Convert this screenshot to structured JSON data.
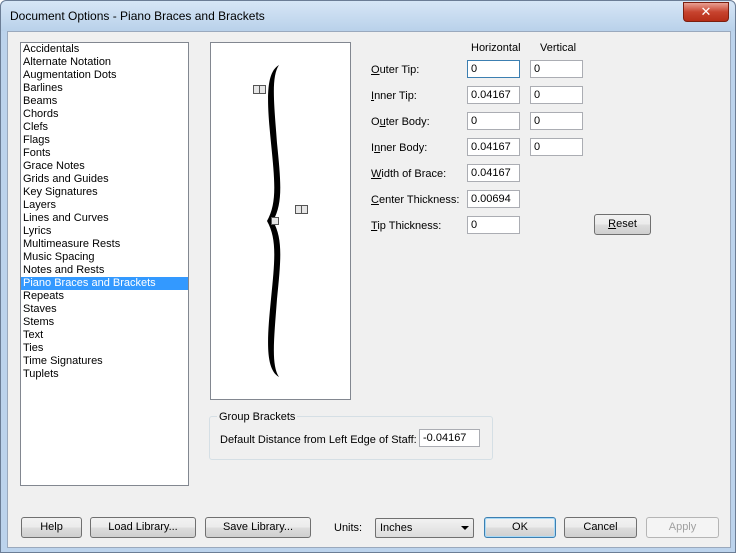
{
  "window": {
    "title": "Document Options - Piano Braces and Brackets",
    "close_symbol": "✕"
  },
  "categories": [
    {
      "label": "Accidentals",
      "selected": false
    },
    {
      "label": "Alternate Notation",
      "selected": false
    },
    {
      "label": "Augmentation Dots",
      "selected": false
    },
    {
      "label": "Barlines",
      "selected": false
    },
    {
      "label": "Beams",
      "selected": false
    },
    {
      "label": "Chords",
      "selected": false
    },
    {
      "label": "Clefs",
      "selected": false
    },
    {
      "label": "Flags",
      "selected": false
    },
    {
      "label": "Fonts",
      "selected": false
    },
    {
      "label": "Grace Notes",
      "selected": false
    },
    {
      "label": "Grids and Guides",
      "selected": false
    },
    {
      "label": "Key Signatures",
      "selected": false
    },
    {
      "label": "Layers",
      "selected": false
    },
    {
      "label": "Lines and Curves",
      "selected": false
    },
    {
      "label": "Lyrics",
      "selected": false
    },
    {
      "label": "Multimeasure Rests",
      "selected": false
    },
    {
      "label": "Music Spacing",
      "selected": false
    },
    {
      "label": "Notes and Rests",
      "selected": false
    },
    {
      "label": "Piano Braces and Brackets",
      "selected": true
    },
    {
      "label": "Repeats",
      "selected": false
    },
    {
      "label": "Staves",
      "selected": false
    },
    {
      "label": "Stems",
      "selected": false
    },
    {
      "label": "Text",
      "selected": false
    },
    {
      "label": "Ties",
      "selected": false
    },
    {
      "label": "Time Signatures",
      "selected": false
    },
    {
      "label": "Tuplets",
      "selected": false
    }
  ],
  "columns": {
    "horizontal": "Horizontal",
    "vertical": "Vertical"
  },
  "fields": {
    "outer_tip": {
      "label_u": "O",
      "label_rest": "uter Tip:",
      "h": "0",
      "v": "0"
    },
    "inner_tip": {
      "label_u": "I",
      "label_rest": "nner Tip:",
      "h": "0.04167",
      "v": "0"
    },
    "outer_body": {
      "label_pre": "O",
      "label_u": "u",
      "label_rest": "ter Body:",
      "h": "0",
      "v": "0"
    },
    "inner_body": {
      "label_pre": "I",
      "label_u": "n",
      "label_rest": "ner Body:",
      "h": "0.04167",
      "v": "0"
    },
    "width_of_brace": {
      "label_u": "W",
      "label_rest": "idth of Brace:",
      "h": "0.04167"
    },
    "center_thickness": {
      "label_u": "C",
      "label_rest": "enter Thickness:",
      "h": "0.00694"
    },
    "tip_thickness": {
      "label_u": "T",
      "label_rest": "ip Thickness:",
      "h": "0"
    }
  },
  "reset_button": {
    "label_u": "R",
    "label_rest": "eset"
  },
  "group_brackets": {
    "legend": "Group Brackets",
    "distance_label": "Default Distance from Left Edge of Staff:",
    "distance_value": "-0.04167"
  },
  "footer": {
    "help": "Help",
    "load_library": "Load Library...",
    "save_library": "Save Library...",
    "units_label": "Units:",
    "units_value": "Inches",
    "ok": "OK",
    "cancel": "Cancel",
    "apply": "Apply"
  }
}
